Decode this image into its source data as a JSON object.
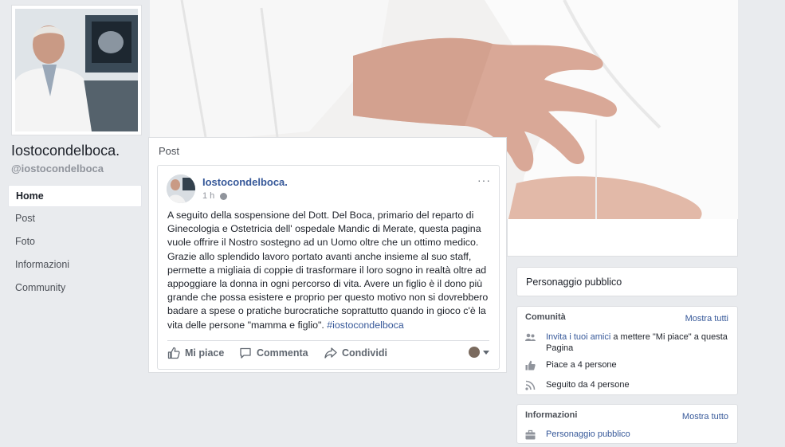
{
  "page": {
    "name": "Iostocondelboca.",
    "handle": "@iostocondelboca"
  },
  "nav": {
    "items": [
      "Home",
      "Post",
      "Foto",
      "Informazioni",
      "Community"
    ]
  },
  "posts": {
    "section_title": "Post",
    "post": {
      "author": "Iostocondelboca.",
      "time": "1 h",
      "more": "···",
      "text": "A seguito della sospensione del Dott. Del Boca, primario del reparto di Ginecologia e Ostetricia dell' ospedale Mandic di Merate, questa pagina vuole offrire il Nostro sostegno ad un Uomo oltre che un ottimo medico. Grazie allo splendido lavoro portato avanti anche insieme al suo staff, permette a migliaia di coppie di trasformare il loro sogno in realtà oltre ad appoggiare la donna in ogni percorso di vita. Avere un figlio è il dono più grande che possa esistere e proprio per questo motivo non si dovrebbero badare a spese o pratiche burocratiche soprattutto quando in gioco c'è la vita delle persone \"mamma e figlio\".",
      "hashtag": "#iostocondelboca",
      "actions": {
        "like": "Mi piace",
        "comment": "Commenta",
        "share": "Condividi"
      }
    }
  },
  "right": {
    "category": "Personaggio pubblico",
    "community": {
      "title": "Comunità",
      "see_all": "Mostra tutti",
      "invite_link": "Invita i tuoi amici",
      "invite_rest": " a mettere \"Mi piace\" a questa Pagina",
      "likes": "Piace a 4 persone",
      "follows": "Seguito da 4 persone"
    },
    "info": {
      "title": "Informazioni",
      "see_all": "Mostra tutto",
      "category_link": "Personaggio pubblico"
    }
  },
  "colors": {
    "link": "#365899",
    "background": "#e9ebee",
    "muted": "#90949c"
  }
}
